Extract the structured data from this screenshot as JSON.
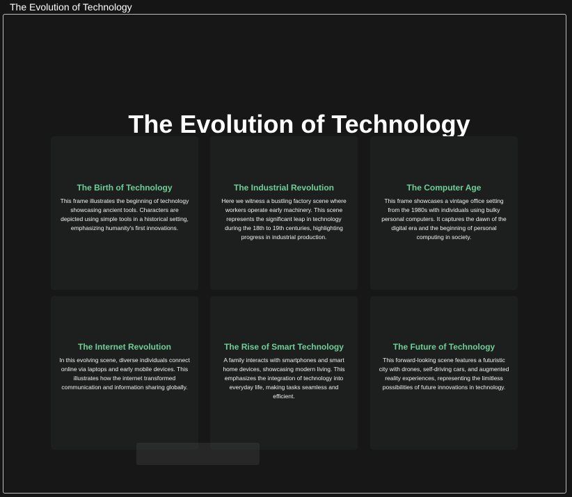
{
  "window": {
    "title": "The Evolution of Technology"
  },
  "main": {
    "heading": "The Evolution of Technology",
    "cards": [
      {
        "title": "The Birth of Technology",
        "description": "This frame illustrates the beginning of technology showcasing ancient tools. Characters are depicted using simple tools in a historical setting, emphasizing humanity's first innovations."
      },
      {
        "title": "The Industrial Revolution",
        "description": "Here we witness a bustling factory scene where workers operate early machinery. This scene represents the significant leap in technology during the 18th to 19th centuries, highlighting progress in industrial production."
      },
      {
        "title": "The Computer Age",
        "description": "This frame showcases a vintage office setting from the 1980s with individuals using bulky personal computers. It captures the dawn of the digital era and the beginning of personal computing in society."
      },
      {
        "title": "The Internet Revolution",
        "description": "In this evolving scene, diverse individuals connect online via laptops and early mobile devices. This illustrates how the internet transformed communication and information sharing globally."
      },
      {
        "title": "The Rise of Smart Technology",
        "description": "A family interacts with smartphones and smart home devices, showcasing modern living. This emphasizes the integration of technology into everyday life, making tasks seamless and efficient."
      },
      {
        "title": "The Future of Technology",
        "description": "This forward-looking scene features a futuristic city with drones, self-driving cars, and augmented reality experiences, representing the limitless possibilities of future innovations in technology."
      }
    ]
  },
  "colors": {
    "background": "#151515",
    "card": "#1c1f1e",
    "accent": "#6fcf97",
    "text": "#ffffff"
  }
}
